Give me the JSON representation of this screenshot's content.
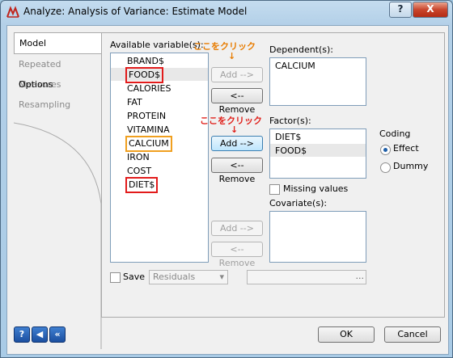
{
  "window": {
    "title": "Analyze: Analysis of Variance: Estimate Model",
    "help_glyph": "?",
    "close_glyph": "X"
  },
  "tabs": [
    {
      "label": "Model",
      "state": "selected"
    },
    {
      "label": "Repeated Measures",
      "state": "disabled"
    },
    {
      "label": "Options",
      "state": "enabled"
    },
    {
      "label": "Resampling",
      "state": "disabled"
    }
  ],
  "available": {
    "label": "Available variable(s):",
    "items": [
      "BRAND$",
      "FOOD$",
      "CALORIES",
      "FAT",
      "PROTEIN",
      "VITAMINA",
      "CALCIUM",
      "IRON",
      "COST",
      "DIET$"
    ]
  },
  "annotations": {
    "top": "ここをクリック",
    "middle": "ここをクリック",
    "arrow": "↓"
  },
  "dependent": {
    "label": "Dependent(s):",
    "items": [
      "CALCIUM"
    ],
    "add_label": "Add -->",
    "remove_label": "<-- Remove"
  },
  "factor": {
    "label": "Factor(s):",
    "items": [
      "DIET$",
      "FOOD$"
    ],
    "add_label": "Add -->",
    "remove_label": "<-- Remove"
  },
  "coding": {
    "label": "Coding",
    "options": [
      "Effect",
      "Dummy"
    ],
    "selected": "Effect"
  },
  "missing_values_label": "Missing values",
  "covariate": {
    "label": "Covariate(s):",
    "add_label": "Add -->",
    "remove_label": "<-- Remove"
  },
  "save": {
    "label": "Save",
    "select_value": "Residuals",
    "path_button": "..."
  },
  "footer": {
    "ok_label": "OK",
    "cancel_label": "Cancel",
    "help_glyph": "?"
  },
  "colors": {
    "highlight_red": "#e21b1b",
    "highlight_orange": "#f0a020",
    "annotation_red": "#e0201a",
    "annotation_orange": "#e87c00"
  }
}
